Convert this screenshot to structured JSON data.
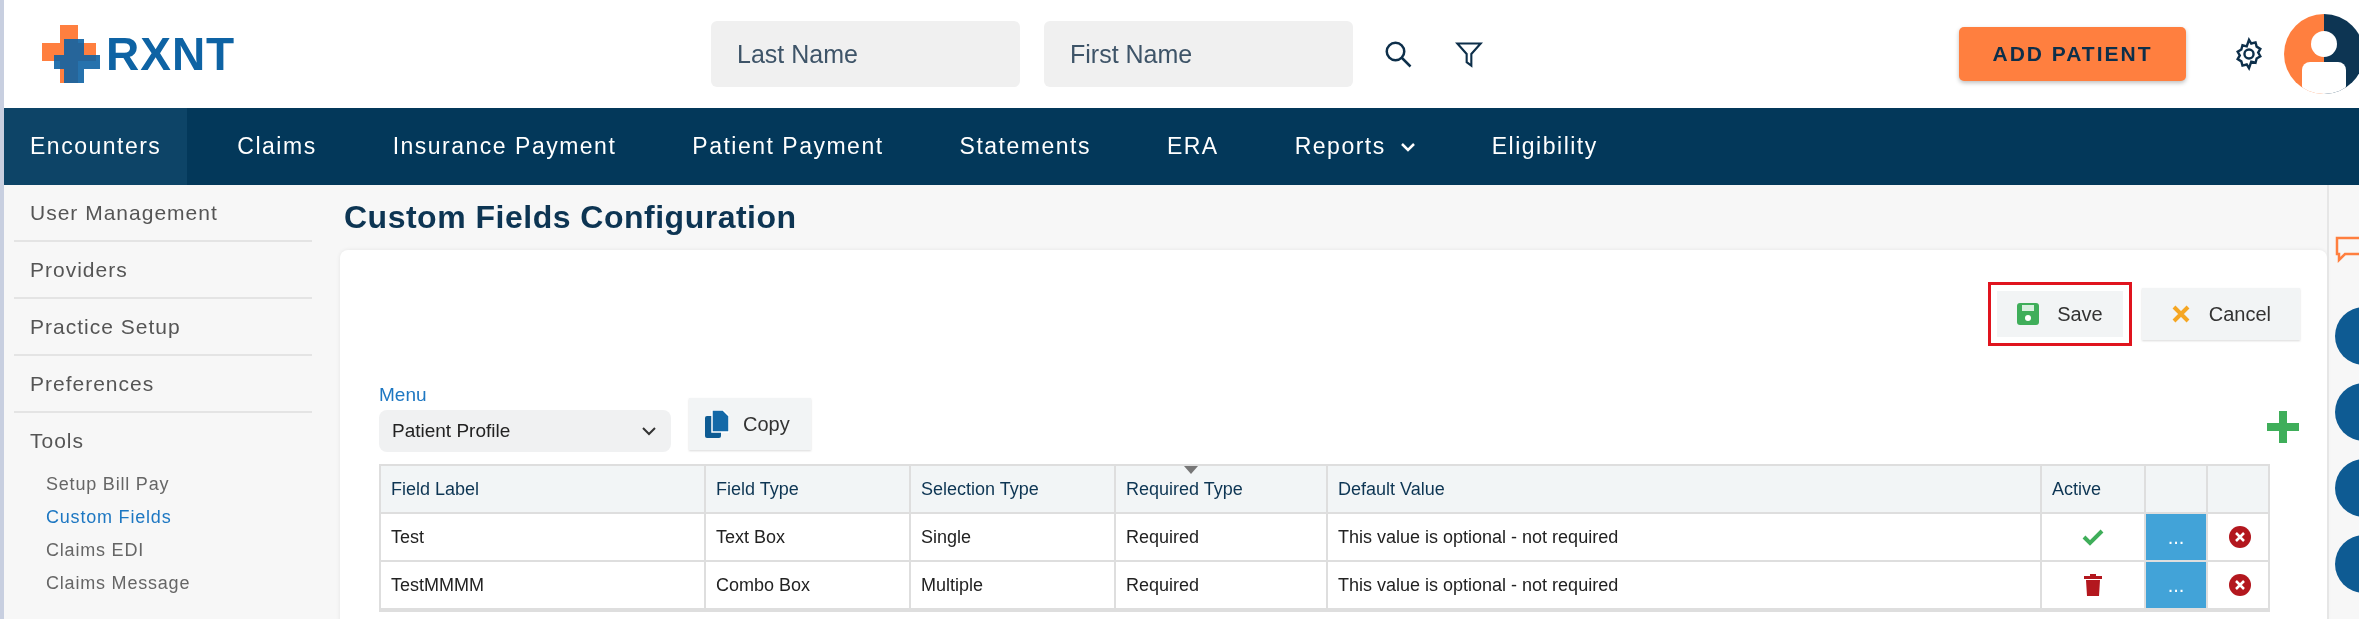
{
  "logo": {
    "text": "RXNT"
  },
  "search": {
    "last_name_placeholder": "Last Name",
    "first_name_placeholder": "First Name"
  },
  "add_patient_button": "ADD PATIENT",
  "nav": [
    {
      "label": "Encounters",
      "selected": true,
      "has_menu": false
    },
    {
      "label": "Claims",
      "selected": false,
      "has_menu": false
    },
    {
      "label": "Insurance Payment",
      "selected": false,
      "has_menu": false
    },
    {
      "label": "Patient Payment",
      "selected": false,
      "has_menu": false
    },
    {
      "label": "Statements",
      "selected": false,
      "has_menu": false
    },
    {
      "label": "ERA",
      "selected": false,
      "has_menu": false
    },
    {
      "label": "Reports",
      "selected": false,
      "has_menu": true
    },
    {
      "label": "Eligibility",
      "selected": false,
      "has_menu": false
    }
  ],
  "sidebar": {
    "items": [
      {
        "label": "User Management",
        "selected": false
      },
      {
        "label": "Providers",
        "selected": false
      },
      {
        "label": "Practice Setup",
        "selected": false
      },
      {
        "label": "Preferences",
        "selected": false
      },
      {
        "label": "Tools",
        "selected": false,
        "children": [
          {
            "label": "Setup Bill Pay",
            "selected": false
          },
          {
            "label": "Custom Fields",
            "selected": true
          },
          {
            "label": "Claims EDI",
            "selected": false
          },
          {
            "label": "Claims Message",
            "selected": false
          }
        ]
      }
    ]
  },
  "page_title": "Custom Fields Configuration",
  "actions": [
    {
      "kind": "save",
      "label": "Save",
      "highlighted": true
    },
    {
      "kind": "cancel",
      "label": "Cancel",
      "highlighted": false
    }
  ],
  "menu_field": {
    "label": "Menu",
    "value": "Patient Profile"
  },
  "copy_button": "Copy",
  "table": {
    "columns": [
      {
        "label": "Field Label",
        "sorted": false
      },
      {
        "label": "Field Type",
        "sorted": false
      },
      {
        "label": "Selection Type",
        "sorted": false
      },
      {
        "label": "Required Type",
        "sorted": true
      },
      {
        "label": "Default Value",
        "sorted": false
      },
      {
        "label": "Active",
        "sorted": false
      }
    ],
    "more_button": "...",
    "rows": [
      {
        "cells": [
          "Test",
          "Text Box",
          "Single",
          "Required",
          "This value is optional - not required"
        ],
        "active": true
      },
      {
        "cells": [
          "TestMMMM",
          "Combo Box",
          "Multiple",
          "Required",
          "This value is optional - not required"
        ],
        "active": false
      }
    ]
  }
}
